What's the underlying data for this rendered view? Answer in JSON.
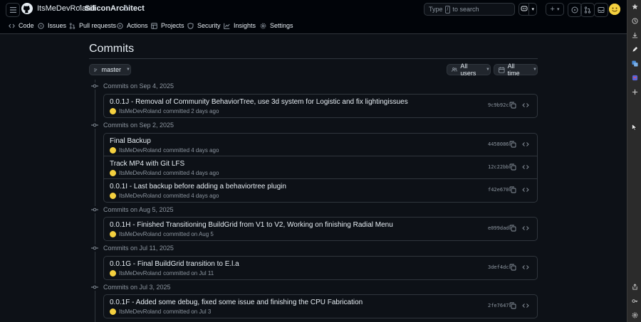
{
  "header": {
    "owner": "ItsMeDevRoland",
    "separator": "/",
    "repo": "SiliconArchitect",
    "search_prefix": "Type",
    "search_key": "/",
    "search_suffix": "to search",
    "plus": "+"
  },
  "tabs": [
    {
      "label": "Code"
    },
    {
      "label": "Issues"
    },
    {
      "label": "Pull requests"
    },
    {
      "label": "Actions"
    },
    {
      "label": "Projects"
    },
    {
      "label": "Security"
    },
    {
      "label": "Insights"
    },
    {
      "label": "Settings"
    }
  ],
  "page": {
    "title": "Commits",
    "branch": "master",
    "users_filter": "All users",
    "time_filter": "All time"
  },
  "groups": [
    {
      "heading": "Commits on Sep 4, 2025",
      "commits": [
        {
          "title": "0.0.1J - Removal of Community BehaviorTree, use 3d system for Logistic and fix lightingissues",
          "author": "ItsMeDevRoland",
          "action": "committed 2 days ago",
          "sha": "9c9b92c"
        }
      ]
    },
    {
      "heading": "Commits on Sep 2, 2025",
      "commits": [
        {
          "title": "Final Backup",
          "author": "ItsMeDevRoland",
          "action": "committed 4 days ago",
          "sha": "4458086"
        },
        {
          "title": "Track MP4 with Git LFS",
          "author": "ItsMeDevRoland",
          "action": "committed 4 days ago",
          "sha": "12c22bb"
        },
        {
          "title": "0.0.1I - Last backup before adding a behaviortree plugin",
          "author": "ItsMeDevRoland",
          "action": "committed 4 days ago",
          "sha": "f42e670"
        }
      ]
    },
    {
      "heading": "Commits on Aug 5, 2025",
      "commits": [
        {
          "title": "0.0.1H - Finished Transitioning BuildGrid from V1 to V2, Working on finishing Radial Menu",
          "author": "ItsMeDevRoland",
          "action": "committed on Aug 5",
          "sha": "e099dad"
        }
      ]
    },
    {
      "heading": "Commits on Jul 11, 2025",
      "commits": [
        {
          "title": "0.0.1G - Final BuildGrid transition to E.l.a",
          "author": "ItsMeDevRoland",
          "action": "committed on Jul 11",
          "sha": "3def4dc"
        }
      ]
    },
    {
      "heading": "Commits on Jul 3, 2025",
      "commits": [
        {
          "title": "0.0.1F - Added some debug, fixed some issue and finishing the CPU Fabrication",
          "author": "ItsMeDevRoland",
          "action": "committed on Jul 3",
          "sha": "2fe7647"
        }
      ]
    }
  ],
  "icons": {
    "menu": "hamburger-icon",
    "logo": "github-logo",
    "lock": "lock-icon",
    "copy": "copy-icon",
    "browse": "code-brackets-icon",
    "commit": "git-commit-icon"
  },
  "colors": {
    "background": "#0d1117",
    "header": "#010409",
    "border": "#30363d",
    "text": "#e6edf3",
    "muted": "#8d96a0",
    "avatar": "#f4d03f",
    "side_panel": "#2b2b2b"
  }
}
